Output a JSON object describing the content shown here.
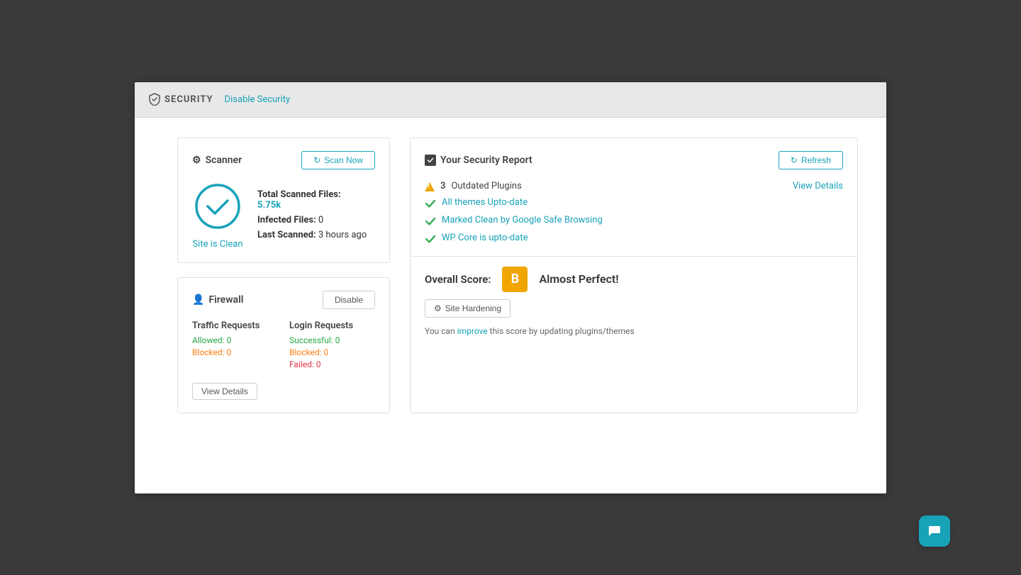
{
  "topbar": {
    "title": "SECURITY",
    "disable_link": "Disable Security"
  },
  "scanner": {
    "title": "Scanner",
    "scan_button": "Scan Now",
    "status_label": "Site is Clean",
    "total_scanned_label": "Total Scanned Files:",
    "total_scanned_value": "5.75k",
    "infected_label": "Infected Files:",
    "infected_value": "0",
    "last_scanned_label": "Last Scanned:",
    "last_scanned_value": "3 hours ago"
  },
  "firewall": {
    "title": "Firewall",
    "disable_button": "Disable",
    "traffic_title": "Traffic Requests",
    "traffic_allowed": "Allowed: 0",
    "traffic_blocked": "Blocked: 0",
    "login_title": "Login Requests",
    "login_successful": "Successful: 0",
    "login_blocked": "Blocked: 0",
    "login_failed": "Failed: 0",
    "view_details_button": "View Details"
  },
  "security_report": {
    "title": "Your Security Report",
    "refresh_button": "Refresh",
    "view_details_link": "View Details",
    "items": [
      {
        "type": "warning",
        "count": "3",
        "text": "Outdated Plugins"
      },
      {
        "type": "success",
        "text": "All themes Upto-date"
      },
      {
        "type": "success",
        "text": "Marked Clean by Google Safe Browsing"
      },
      {
        "type": "success",
        "text": "WP Core is upto-date"
      }
    ],
    "overall_score_label": "Overall Score:",
    "grade": "B",
    "grade_text": "Almost Perfect!",
    "site_hardening_button": "Site Hardening",
    "score_note": "You can improve this score by updating plugins/themes"
  },
  "chat": {
    "label": "Chat"
  }
}
